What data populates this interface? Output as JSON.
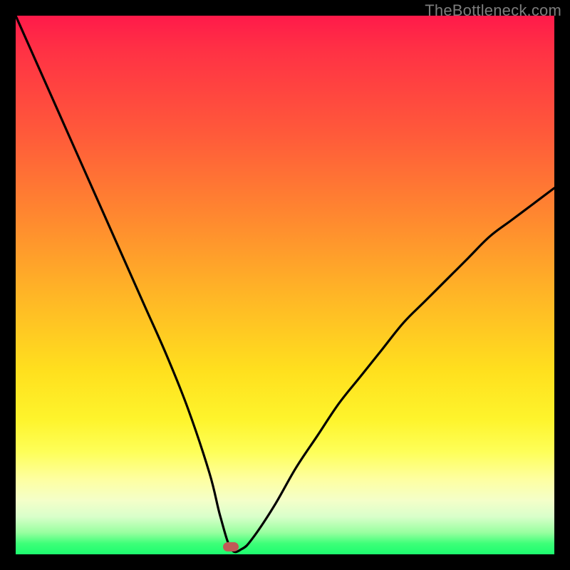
{
  "watermark": "TheBottleneck.com",
  "colors": {
    "frame_bg": "#000000",
    "curve": "#000000",
    "marker": "#c15a57"
  },
  "chart_data": {
    "type": "line",
    "title": "",
    "xlabel": "",
    "ylabel": "",
    "xlim": [
      0,
      100
    ],
    "ylim": [
      0,
      100
    ],
    "grid": false,
    "legend": false,
    "annotations": [
      {
        "name": "marker",
        "x": 40,
        "y": 1.5,
        "color": "#c15a57"
      }
    ],
    "series": [
      {
        "name": "bottleneck-curve",
        "x": [
          0,
          4,
          8,
          12,
          16,
          20,
          24,
          28,
          32,
          36,
          38,
          40,
          42,
          44,
          48,
          52,
          56,
          60,
          64,
          68,
          72,
          76,
          80,
          84,
          88,
          92,
          96,
          100
        ],
        "y": [
          100,
          91,
          82,
          73,
          64,
          55,
          46,
          37,
          27,
          15,
          7,
          1,
          1,
          3,
          9,
          16,
          22,
          28,
          33,
          38,
          43,
          47,
          51,
          55,
          59,
          62,
          65,
          68
        ]
      }
    ]
  }
}
